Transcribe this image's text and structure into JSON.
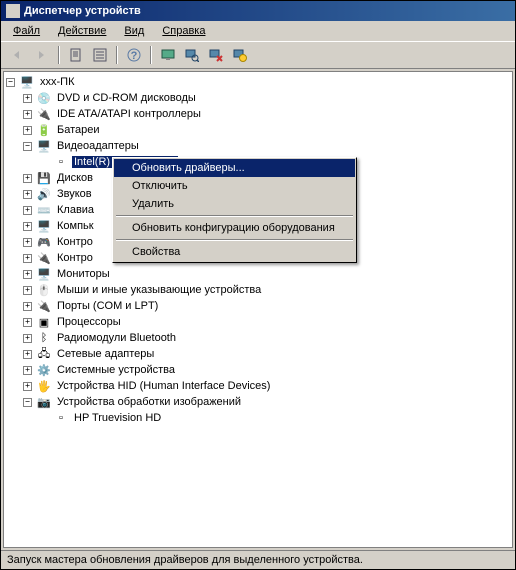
{
  "window": {
    "title": "Диспетчер устройств"
  },
  "menu": {
    "file": "Файл",
    "action": "Действие",
    "view": "Вид",
    "help": "Справка"
  },
  "tree": {
    "root": "xxx-ПК",
    "items": [
      {
        "label": "DVD и CD-ROM дисководы",
        "exp": "+"
      },
      {
        "label": "IDE ATA/ATAPI контроллеры",
        "exp": "+"
      },
      {
        "label": "Батареи",
        "exp": "+"
      },
      {
        "label": "Видеоадаптеры",
        "exp": "-",
        "children": [
          {
            "label": "Intel(R) HD Graphics",
            "selected": true
          }
        ]
      },
      {
        "label": "Дисков",
        "exp": "+"
      },
      {
        "label": "Звуков",
        "exp": "+"
      },
      {
        "label": "Клавиа",
        "exp": "+"
      },
      {
        "label": "Компьк",
        "exp": "+"
      },
      {
        "label": "Контро",
        "exp": "+"
      },
      {
        "label": "Контро",
        "exp": "+"
      },
      {
        "label": "Мониторы",
        "exp": "+"
      },
      {
        "label": "Мыши и иные указывающие устройства",
        "exp": "+"
      },
      {
        "label": "Порты (COM и LPT)",
        "exp": "+"
      },
      {
        "label": "Процессоры",
        "exp": "+"
      },
      {
        "label": "Радиомодули Bluetooth",
        "exp": "+"
      },
      {
        "label": "Сетевые адаптеры",
        "exp": "+"
      },
      {
        "label": "Системные устройства",
        "exp": "+"
      },
      {
        "label": "Устройства HID (Human Interface Devices)",
        "exp": "+"
      },
      {
        "label": "Устройства обработки изображений",
        "exp": "-",
        "children": [
          {
            "label": "HP Truevision HD"
          }
        ]
      }
    ]
  },
  "context_menu": {
    "update": "Обновить драйверы...",
    "disable": "Отключить",
    "delete": "Удалить",
    "refresh": "Обновить конфигурацию оборудования",
    "properties": "Свойства"
  },
  "status": "Запуск мастера обновления драйверов для выделенного устройства."
}
